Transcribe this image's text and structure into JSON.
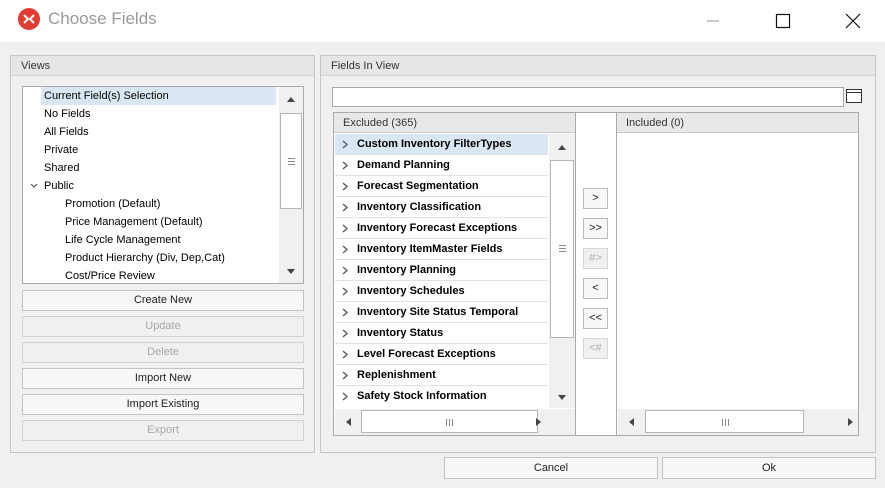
{
  "window": {
    "title": "Choose Fields"
  },
  "views": {
    "header": "Views",
    "items": [
      {
        "label": "Current Field(s) Selection"
      },
      {
        "label": "No Fields"
      },
      {
        "label": "All Fields"
      },
      {
        "label": "Private"
      },
      {
        "label": "Shared"
      },
      {
        "label": "Public"
      },
      {
        "label": "Promotion (Default)"
      },
      {
        "label": "Price Management (Default)"
      },
      {
        "label": "Life Cycle Management"
      },
      {
        "label": "Product Hierarchy (Div, Dep,Cat)"
      },
      {
        "label": "Cost/Price Review"
      }
    ],
    "buttons": {
      "create_new": "Create New",
      "update": "Update",
      "delete": "Delete",
      "import_new": "Import New",
      "import_existing": "Import Existing",
      "export": "Export"
    }
  },
  "fields": {
    "header": "Fields In View",
    "search_value": "",
    "excluded_header": "Excluded (365)",
    "included_header": "Included (0)",
    "excluded_items": [
      {
        "label": "Custom Inventory FilterTypes"
      },
      {
        "label": "Demand Planning"
      },
      {
        "label": "Forecast Segmentation"
      },
      {
        "label": "Inventory Classification"
      },
      {
        "label": "Inventory Forecast Exceptions"
      },
      {
        "label": "Inventory ItemMaster Fields"
      },
      {
        "label": "Inventory Planning"
      },
      {
        "label": "Inventory Schedules"
      },
      {
        "label": "Inventory Site Status Temporal"
      },
      {
        "label": "Inventory Status"
      },
      {
        "label": "Level Forecast Exceptions"
      },
      {
        "label": "Replenishment"
      },
      {
        "label": "Safety Stock Information"
      }
    ],
    "transfer_buttons": {
      "add": ">",
      "add_all": ">>",
      "add_hash": "#>",
      "remove": "<",
      "remove_all": "<<",
      "remove_hash": "<#"
    }
  },
  "footer": {
    "cancel": "Cancel",
    "ok": "Ok"
  },
  "colors": {
    "accent": "#e03c31",
    "selection": "#dbe6f4"
  }
}
